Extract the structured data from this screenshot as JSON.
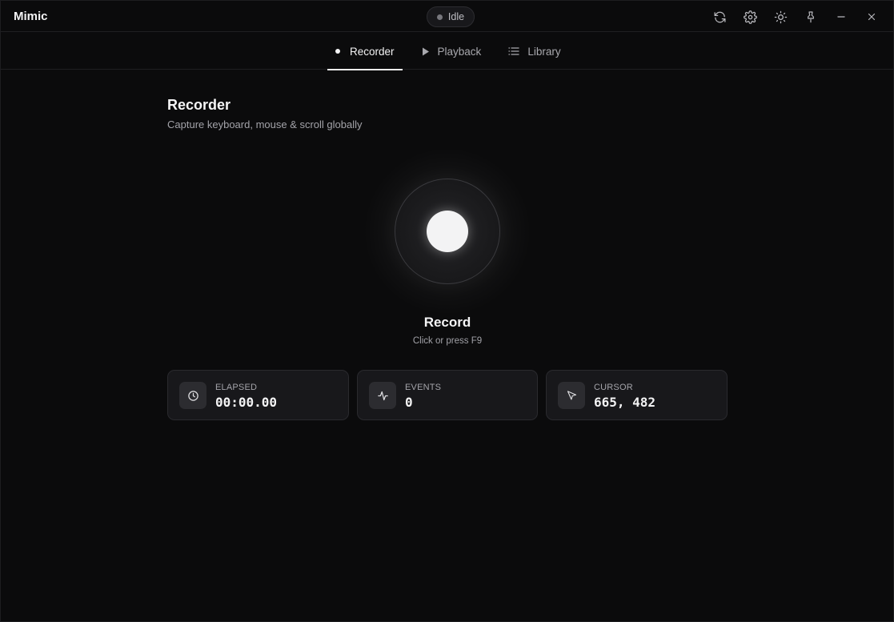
{
  "app": {
    "title": "Mimic",
    "status": "Idle"
  },
  "titlebar": {
    "actions": [
      {
        "name": "refresh-icon"
      },
      {
        "name": "gear-icon"
      },
      {
        "name": "sun-icon"
      },
      {
        "name": "pin-icon"
      },
      {
        "name": "minimize-icon"
      },
      {
        "name": "close-icon"
      }
    ]
  },
  "tabs": [
    {
      "label": "Recorder",
      "icon": "dot-icon",
      "active": true
    },
    {
      "label": "Playback",
      "icon": "play-icon",
      "active": false
    },
    {
      "label": "Library",
      "icon": "list-icon",
      "active": false
    }
  ],
  "recorder": {
    "title": "Recorder",
    "subtitle": "Capture keyboard, mouse & scroll globally",
    "record_label": "Record",
    "record_hint": "Click or press F9"
  },
  "stats": {
    "elapsed": {
      "label": "ELAPSED",
      "value": "00:00.00",
      "icon": "clock-icon"
    },
    "events": {
      "label": "EVENTS",
      "value": "0",
      "icon": "activity-icon"
    },
    "cursor": {
      "label": "CURSOR",
      "value": "665, 482",
      "icon": "cursor-icon"
    }
  },
  "colors": {
    "background": "#0b0b0c",
    "card": "#18181b",
    "accent": "#f3f3f4",
    "muted_text": "#a3a3a9"
  }
}
